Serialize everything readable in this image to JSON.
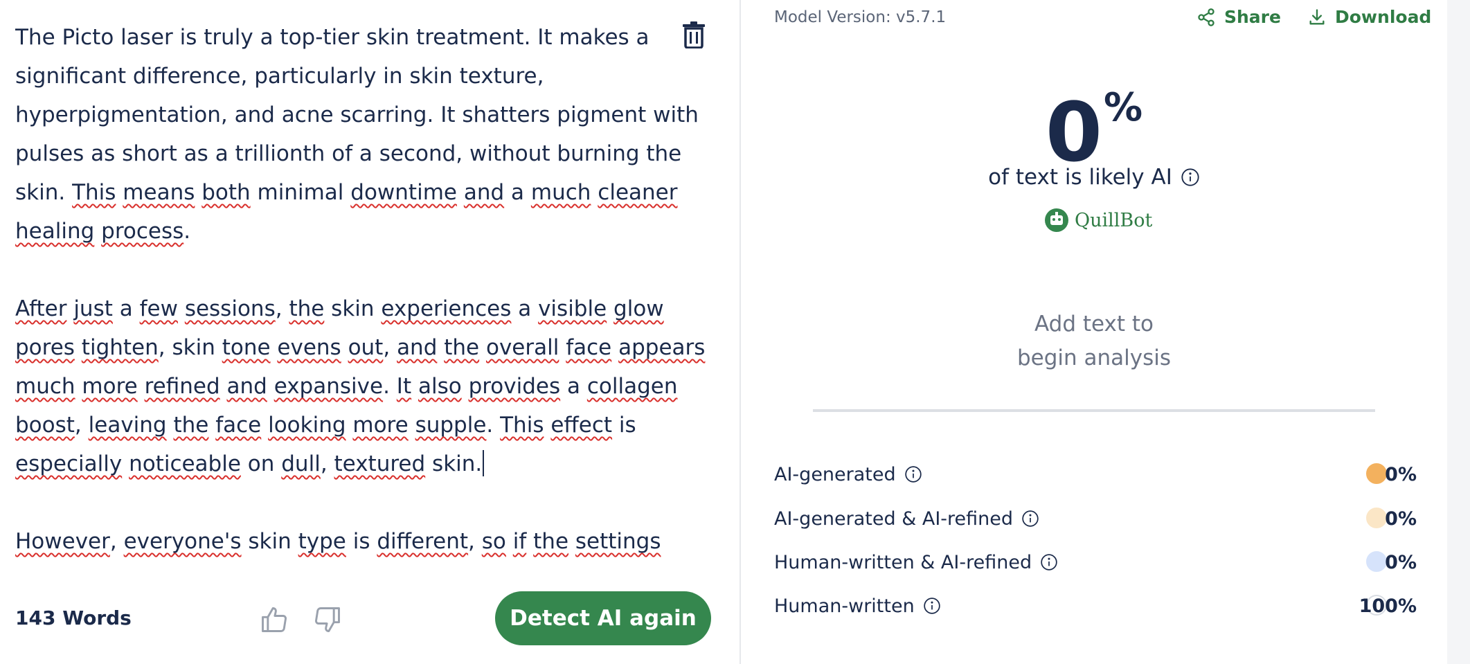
{
  "editor": {
    "paragraphs": [
      [
        {
          "t": "The Picto laser is truly a top-tier skin treatment. It makes a "
        },
        {
          "t": "significant difference, particularly in skin texture, "
        },
        {
          "t": "hyperpigmentation, and acne scarring. It shatters pigment with "
        },
        {
          "t": "pulses as short as a trillionth of a second, without burning the "
        },
        {
          "t": "skin. "
        },
        {
          "t": "This",
          "s": true
        },
        {
          "t": " "
        },
        {
          "t": "means",
          "s": true
        },
        {
          "t": " "
        },
        {
          "t": "both",
          "s": true
        },
        {
          "t": " minimal "
        },
        {
          "t": "downtime",
          "s": true
        },
        {
          "t": " "
        },
        {
          "t": "and",
          "s": true
        },
        {
          "t": " a "
        },
        {
          "t": "much",
          "s": true
        },
        {
          "t": " "
        },
        {
          "t": "cleaner",
          "s": true
        },
        {
          "t": " "
        },
        {
          "t": "healing",
          "s": true
        },
        {
          "t": " "
        },
        {
          "t": "process",
          "s": true
        },
        {
          "t": "."
        }
      ],
      [
        {
          "t": "After",
          "s": true
        },
        {
          "t": " "
        },
        {
          "t": "just",
          "s": true
        },
        {
          "t": " a "
        },
        {
          "t": "few",
          "s": true
        },
        {
          "t": " "
        },
        {
          "t": "sessions",
          "s": true
        },
        {
          "t": ", "
        },
        {
          "t": "the",
          "s": true
        },
        {
          "t": " skin "
        },
        {
          "t": "experiences",
          "s": true
        },
        {
          "t": " a "
        },
        {
          "t": "visible",
          "s": true
        },
        {
          "t": " "
        },
        {
          "t": "glow",
          "s": true
        },
        {
          "t": " "
        },
        {
          "t": "pores",
          "s": true
        },
        {
          "t": " "
        },
        {
          "t": "tighten",
          "s": true
        },
        {
          "t": ", skin "
        },
        {
          "t": "tone",
          "s": true
        },
        {
          "t": " "
        },
        {
          "t": "evens",
          "s": true
        },
        {
          "t": " "
        },
        {
          "t": "out",
          "s": true
        },
        {
          "t": ", "
        },
        {
          "t": "and",
          "s": true
        },
        {
          "t": " "
        },
        {
          "t": "the",
          "s": true
        },
        {
          "t": " "
        },
        {
          "t": "overall",
          "s": true
        },
        {
          "t": " "
        },
        {
          "t": "face",
          "s": true
        },
        {
          "t": " "
        },
        {
          "t": "appears",
          "s": true
        },
        {
          "t": " "
        },
        {
          "t": "much",
          "s": true
        },
        {
          "t": " "
        },
        {
          "t": "more",
          "s": true
        },
        {
          "t": " "
        },
        {
          "t": "refined",
          "s": true
        },
        {
          "t": " "
        },
        {
          "t": "and",
          "s": true
        },
        {
          "t": " "
        },
        {
          "t": "expansive",
          "s": true
        },
        {
          "t": ". "
        },
        {
          "t": "It",
          "s": true
        },
        {
          "t": " "
        },
        {
          "t": "also",
          "s": true
        },
        {
          "t": " "
        },
        {
          "t": "provides",
          "s": true
        },
        {
          "t": " a "
        },
        {
          "t": "collagen",
          "s": true
        },
        {
          "t": " "
        },
        {
          "t": "boost",
          "s": true
        },
        {
          "t": ", "
        },
        {
          "t": "leaving",
          "s": true
        },
        {
          "t": " "
        },
        {
          "t": "the",
          "s": true
        },
        {
          "t": " "
        },
        {
          "t": "face",
          "s": true
        },
        {
          "t": " "
        },
        {
          "t": "looking",
          "s": true
        },
        {
          "t": " "
        },
        {
          "t": "more",
          "s": true
        },
        {
          "t": " "
        },
        {
          "t": "supple",
          "s": true
        },
        {
          "t": ". "
        },
        {
          "t": "This",
          "s": true
        },
        {
          "t": " "
        },
        {
          "t": "effect",
          "s": true
        },
        {
          "t": " is "
        },
        {
          "t": "especially",
          "s": true
        },
        {
          "t": " "
        },
        {
          "t": "noticeable",
          "s": true
        },
        {
          "t": " on "
        },
        {
          "t": "dull",
          "s": true
        },
        {
          "t": ", "
        },
        {
          "t": "textured",
          "s": true
        },
        {
          "t": " skin."
        }
      ],
      [
        {
          "t": "However",
          "s": true
        },
        {
          "t": ", "
        },
        {
          "t": "everyone's",
          "s": true
        },
        {
          "t": " skin "
        },
        {
          "t": "type",
          "s": true
        },
        {
          "t": " is "
        },
        {
          "t": "different",
          "s": true
        },
        {
          "t": ", "
        },
        {
          "t": "so",
          "s": true
        },
        {
          "t": " "
        },
        {
          "t": "if",
          "s": true
        },
        {
          "t": " "
        },
        {
          "t": "the",
          "s": true
        },
        {
          "t": " "
        },
        {
          "t": "settings",
          "s": true
        }
      ]
    ],
    "word_count": "143 Words",
    "detect_button": "Detect AI again",
    "spellcheck_color": "#d9302c"
  },
  "results": {
    "model_version": "Model Version: v5.7.1",
    "share_label": "Share",
    "download_label": "Download",
    "score_value": "0",
    "score_unit": "%",
    "score_caption": "of text is likely AI",
    "brand_name": "QuillBot",
    "placeholder_line1": "Add text to",
    "placeholder_line2": "begin analysis",
    "legend": [
      {
        "label": "AI-generated",
        "value": "0%",
        "color": "#f3b15e",
        "border": "#f3b15e"
      },
      {
        "label": "AI-generated & AI-refined",
        "value": "0%",
        "color": "#fbe6c6",
        "border": "#fbe6c6"
      },
      {
        "label": "Human-written & AI-refined",
        "value": "0%",
        "color": "#d6e3fb",
        "border": "#d6e3fb"
      },
      {
        "label": "Human-written",
        "value": "100%",
        "color": "#ffffff",
        "border": "#d9dde3"
      }
    ]
  },
  "colors": {
    "accent_green": "#35874e",
    "text_navy": "#1b2a4a"
  }
}
